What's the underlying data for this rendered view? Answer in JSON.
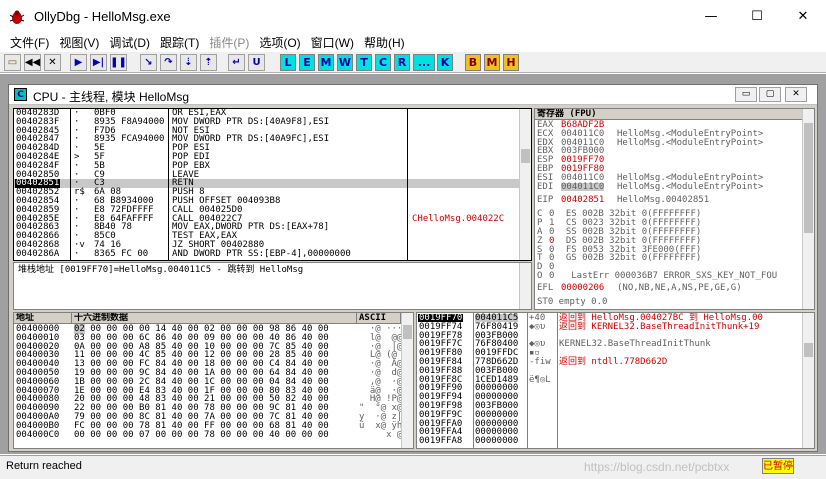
{
  "window": {
    "title": "OllyDbg - HelloMsg.exe",
    "controls": [
      "—",
      "☐",
      "✕"
    ]
  },
  "menu": [
    {
      "label": "文件(F)",
      "disabled": false
    },
    {
      "label": "视图(V)",
      "disabled": false
    },
    {
      "label": "调试(D)",
      "disabled": false
    },
    {
      "label": "跟踪(T)",
      "disabled": false
    },
    {
      "label": "插件(P)",
      "disabled": true
    },
    {
      "label": "选项(O)",
      "disabled": false
    },
    {
      "label": "窗口(W)",
      "disabled": false
    },
    {
      "label": "帮助(H)",
      "disabled": false
    }
  ],
  "toolbar": {
    "letters": [
      "L",
      "E",
      "M",
      "W",
      "T",
      "C",
      "R",
      "...",
      "K"
    ],
    "letters2": [
      "B",
      "M",
      "H"
    ]
  },
  "cpu": {
    "title": "CPU - 主线程, 模块 HelloMsg",
    "controls": [
      "▭",
      "▢",
      "✕"
    ]
  },
  "disasm": {
    "rows": [
      {
        "addr": "0040283D",
        "mark": "·",
        "hex": "0BF0",
        "ins": "OR ESI,EAX",
        "cmt": ""
      },
      {
        "addr": "0040283F",
        "mark": "·",
        "hex": "8935 F8A94000",
        "ins": "MOV DWORD PTR DS:[40A9F8],ESI",
        "cmt": ""
      },
      {
        "addr": "00402845",
        "mark": "·",
        "hex": "F7D6",
        "ins": "NOT ESI",
        "cmt": ""
      },
      {
        "addr": "00402847",
        "mark": "·",
        "hex": "8935 FCA94000",
        "ins": "MOV DWORD PTR DS:[40A9FC],ESI",
        "cmt": ""
      },
      {
        "addr": "0040284D",
        "mark": "·",
        "hex": "5E",
        "ins": "POP ESI",
        "cmt": ""
      },
      {
        "addr": "0040284E",
        "mark": ">",
        "hex": "5F",
        "ins": "POP EDI",
        "cmt": ""
      },
      {
        "addr": "0040284F",
        "mark": "·",
        "hex": "5B",
        "ins": "POP EBX",
        "cmt": ""
      },
      {
        "addr": "00402850",
        "mark": "·",
        "hex": "C9",
        "ins": "LEAVE",
        "cmt": ""
      },
      {
        "addr": "00402851",
        "mark": "·",
        "hex": "C3",
        "ins": "RETN",
        "cmt": ""
      },
      {
        "addr": "00402852",
        "mark": "r$",
        "hex": "6A 08",
        "ins": "PUSH 8",
        "cmt": ""
      },
      {
        "addr": "00402854",
        "mark": "·",
        "hex": "68 B8934000",
        "ins": "PUSH OFFSET 004093B8",
        "cmt": ""
      },
      {
        "addr": "00402859",
        "mark": "·",
        "hex": "E8 72FDFFFF",
        "ins": "CALL 004025D0",
        "cmt": ""
      },
      {
        "addr": "0040285E",
        "mark": "·",
        "hex": "E8 64FAFFFF",
        "ins": "CALL 004022C7",
        "cmt": "CHelloMsg.004022C"
      },
      {
        "addr": "00402863",
        "mark": "·",
        "hex": "8B40 78",
        "ins": "MOV EAX,DWORD PTR DS:[EAX+78]",
        "cmt": ""
      },
      {
        "addr": "00402866",
        "mark": "·",
        "hex": "85C0",
        "ins": "TEST EAX,EAX",
        "cmt": ""
      },
      {
        "addr": "00402868",
        "mark": "·v",
        "hex": "74 16",
        "ins": "JZ SHORT 00402880",
        "cmt": ""
      },
      {
        "addr": "0040286A",
        "mark": "·",
        "hex": "8365 FC 00",
        "ins": "AND DWORD PTR SS:[EBP-4],00000000",
        "cmt": ""
      }
    ],
    "info": "堆栈地址 [0019FF70]=HelloMsg.004011C5 - 跳转到 HelloMsg"
  },
  "registers": {
    "header": "寄存器 (FPU)",
    "rows": [
      {
        "name": "EAX",
        "val": "B68ADF2B",
        "note": "",
        "red": true
      },
      {
        "name": "ECX",
        "val": "004011C0",
        "note": "HelloMsg.<ModuleEntryPoint>",
        "red": false
      },
      {
        "name": "EDX",
        "val": "004011C0",
        "note": "HelloMsg.<ModuleEntryPoint>",
        "red": false
      },
      {
        "name": "EBX",
        "val": "003FB000",
        "note": "",
        "red": false
      },
      {
        "name": "ESP",
        "val": "0019FF70",
        "note": "",
        "red": true
      },
      {
        "name": "EBP",
        "val": "0019FF80",
        "note": "",
        "red": true
      },
      {
        "name": "ESI",
        "val": "004011C0",
        "note": "HelloMsg.<ModuleEntryPoint>",
        "red": false
      },
      {
        "name": "EDI",
        "val": "004011C0",
        "note": "HelloMsg.<ModuleEntryPoint>",
        "red": false
      }
    ],
    "eip": {
      "name": "EIP",
      "val": "00402851",
      "note": "HelloMsg.00402851"
    },
    "flags": [
      "C 0  ES 002B 32bit 0(FFFFFFFF)",
      "P 1  CS 0023 32bit 0(FFFFFFFF)",
      "A 0  SS 002B 32bit 0(FFFFFFFF)",
      "Z 0  DS 002B 32bit 0(FFFFFFFF)",
      "S 0  FS 0053 32bit 3FE000(FFF)",
      "T 0  GS 002B 32bit 0(FFFFFFFF)",
      "D 0",
      "O 0   LastErr 000036B7 ERROR_SXS_KEY_NOT_FOU"
    ],
    "efl": {
      "name": "EFL",
      "val": "00000206",
      "note": "(NO,NB,NE,A,NS,PE,GE,G)"
    },
    "st0": "ST0 empty 0.0"
  },
  "dump": {
    "h_addr": "地址",
    "h_hex": "十六进制数据",
    "h_ascii": "ASCII",
    "rows": [
      {
        "a": "00400000",
        "h": "02 00 00 00 00 14 40 00 02 00 00 00 98 86 40 00",
        "s": "  ·@ ···@ "
      },
      {
        "a": "00400010",
        "h": "03 00 00 00 6C 86 40 00 09 00 00 00 40 86 40 00",
        "s": "  l@  @@ "
      },
      {
        "a": "00400020",
        "h": "0A 00 00 00 A8 85 40 00 10 00 00 00 7C 85 40 00",
        "s": "  ·@  |@ "
      },
      {
        "a": "00400030",
        "h": "11 00 00 00 4C 85 40 00 12 00 00 00 28 85 40 00",
        "s": "  L@ (@ "
      },
      {
        "a": "00400040",
        "h": "13 00 00 00 FC 84 40 00 18 00 00 00 C4 84 40 00",
        "s": "  ·@  Ä@ "
      },
      {
        "a": "00400050",
        "h": "19 00 00 00 9C 84 40 00 1A 00 00 00 64 84 40 00",
        "s": "  ·@  d@ "
      },
      {
        "a": "00400060",
        "h": "1B 00 00 00 2C 84 40 00 1C 00 00 00 04 84 40 00",
        "s": "  ,@  ·@ "
      },
      {
        "a": "00400070",
        "h": "1E 00 00 00 E4 83 40 00 1F 00 00 00 80 83 40 00",
        "s": "  ä@  ·@ "
      },
      {
        "a": "00400080",
        "h": "20 00 00 00 48 83 40 00 21 00 00 00 50 82 40 00",
        "s": "  H@ !P@ "
      },
      {
        "a": "00400090",
        "h": "22 00 00 00 B0 81 40 00 78 00 00 00 9C 81 40 00",
        "s": "\"  °@ x@ "
      },
      {
        "a": "004000A0",
        "h": "79 00 00 00 8C 81 40 00 7A 00 00 00 7C 81 40 00",
        "s": "y  ·@ z|@ "
      },
      {
        "a": "004000B0",
        "h": "FC 00 00 00 78 81 40 00 FF 00 00 00 68 81 40 00",
        "s": "ü  x@ ÿh@ "
      },
      {
        "a": "004000C0",
        "h": "00 00 00 00 07 00 00 00 78 00 00 00 40 00 00 00",
        "s": "     x @ "
      }
    ]
  },
  "stack": {
    "rows": [
      {
        "a": "0019FF70",
        "v": "004011C5",
        "m": "+40",
        "c": "返回到 HelloMsg.004027BC 到 HelloMsg.00",
        "red": true
      },
      {
        "a": "0019FF74",
        "v": "76F80419",
        "m": "◆◎υ",
        "c": "返回到 KERNEL32.BaseThreadInitThunk+19",
        "red": true
      },
      {
        "a": "0019FF78",
        "v": "003FB000",
        "m": "",
        "c": "",
        "red": false
      },
      {
        "a": "0019FF7C",
        "v": "76F80400",
        "m": "◆◎υ",
        "c": "KERNEL32.BaseThreadInitThunk",
        "red": false
      },
      {
        "a": "0019FF80",
        "v": "0019FFDC",
        "m": "▪▫",
        "c": "",
        "red": false
      },
      {
        "a": "0019FF84",
        "v": "778D662D",
        "m": "-fiw",
        "c": "返回到 ntdll.778D662D",
        "red": true
      },
      {
        "a": "0019FF88",
        "v": "003FB000",
        "m": "",
        "c": "",
        "red": false
      },
      {
        "a": "0019FF8C",
        "v": "1CED1489",
        "m": "ë¶◎L",
        "c": "",
        "red": false
      },
      {
        "a": "0019FF90",
        "v": "00000000",
        "m": "",
        "c": "",
        "red": false
      },
      {
        "a": "0019FF94",
        "v": "00000000",
        "m": "",
        "c": "",
        "red": false
      },
      {
        "a": "0019FF98",
        "v": "003FB000",
        "m": "",
        "c": "",
        "red": false
      },
      {
        "a": "0019FF9C",
        "v": "00000000",
        "m": "",
        "c": "",
        "red": false
      },
      {
        "a": "0019FFA0",
        "v": "00000000",
        "m": "",
        "c": "",
        "red": false
      },
      {
        "a": "0019FFA4",
        "v": "00000000",
        "m": "",
        "c": "",
        "red": false
      },
      {
        "a": "0019FFA8",
        "v": "00000000",
        "m": "",
        "c": "",
        "red": false
      }
    ]
  },
  "status": {
    "text": "Return reached",
    "watermark": "https://blog.csdn.net/pcbtxx",
    "badge": "已暂停"
  }
}
